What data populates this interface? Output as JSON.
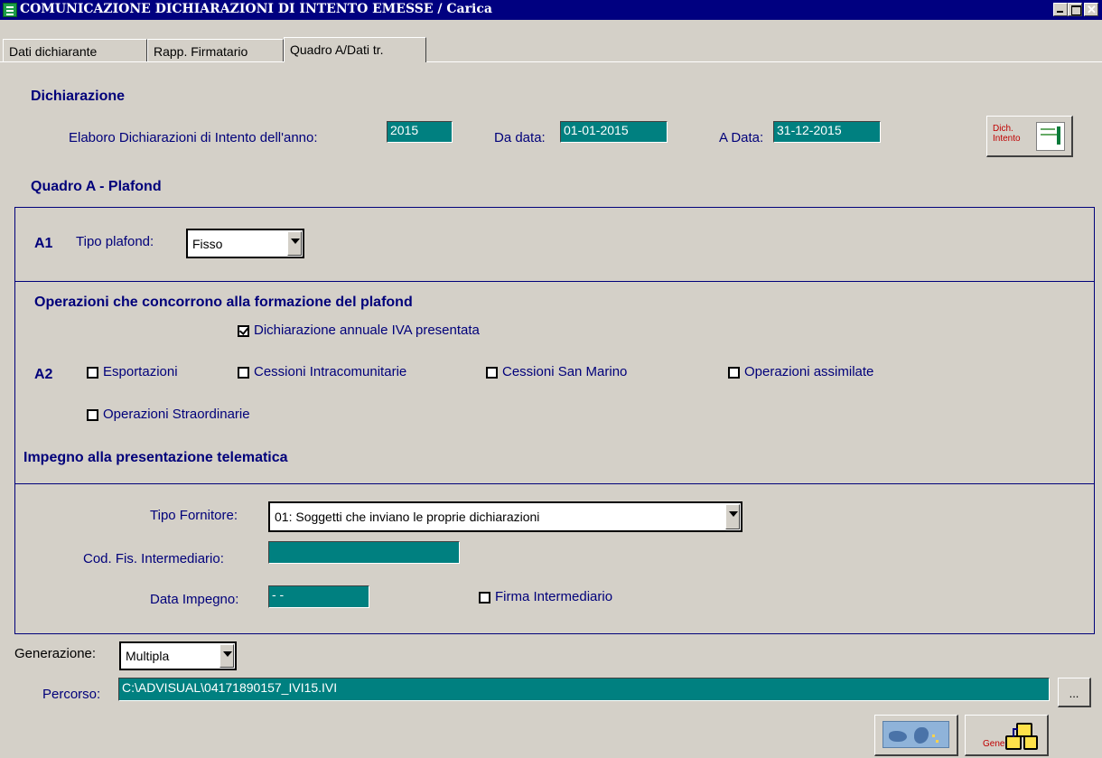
{
  "window": {
    "title": "COMUNICAZIONE DICHIARAZIONI DI INTENTO EMESSE / Carica"
  },
  "tabs": [
    {
      "label": "Dati dichiarante"
    },
    {
      "label": "Rapp. Firmatario"
    },
    {
      "label": "Quadro A/Dati tr."
    }
  ],
  "dichiarazione": {
    "heading": "Dichiarazione",
    "anno_label": "Elaboro Dichiarazioni di Intento dell'anno:",
    "anno_value": "2015",
    "da_data_label": "Da data:",
    "da_data_value": "01-01-2015",
    "a_data_label": "A Data:",
    "a_data_value": "31-12-2015",
    "dich_button": {
      "line1": "Dich.",
      "line2": "Intento"
    }
  },
  "quadro_a": {
    "heading": "Quadro A - Plafond",
    "a1_code": "A1",
    "tipo_plafond_label": "Tipo plafond:",
    "tipo_plafond_value": "Fisso"
  },
  "operazioni": {
    "heading": "Operazioni che concorrono alla formazione del plafond",
    "dichiarazione_annuale": {
      "label": "Dichiarazione annuale IVA presentata",
      "checked": true
    },
    "a2_code": "A2",
    "checkboxes": [
      {
        "label": "Esportazioni",
        "checked": false
      },
      {
        "label": "Cessioni Intracomunitarie",
        "checked": false
      },
      {
        "label": "Cessioni San Marino",
        "checked": false
      },
      {
        "label": "Operazioni assimilate",
        "checked": false
      },
      {
        "label": "Operazioni Straordinarie",
        "checked": false
      }
    ]
  },
  "impegno": {
    "heading": "Impegno alla presentazione telematica",
    "tipo_fornitore_label": "Tipo Fornitore:",
    "tipo_fornitore_value": "01: Soggetti che inviano le proprie dichiarazioni",
    "cod_fis_label": "Cod. Fis. Intermediario:",
    "cod_fis_value": "",
    "data_impegno_label": "Data Impegno:",
    "data_impegno_value": " - -",
    "firma_intermediario": {
      "label": "Firma Intermediario",
      "checked": false
    }
  },
  "generazione": {
    "label": "Generazione:",
    "value": "Multipla",
    "percorso_label": "Percorso:",
    "percorso_value": "C:\\ADVISUAL\\04171890157_IVI15.IVI",
    "browse_label": "...",
    "genera_label": "Genera"
  },
  "colors": {
    "titlebar": "#000080",
    "teal_field": "#008080",
    "label_blue": "#00007a",
    "window_bg": "#d4d0c8"
  }
}
